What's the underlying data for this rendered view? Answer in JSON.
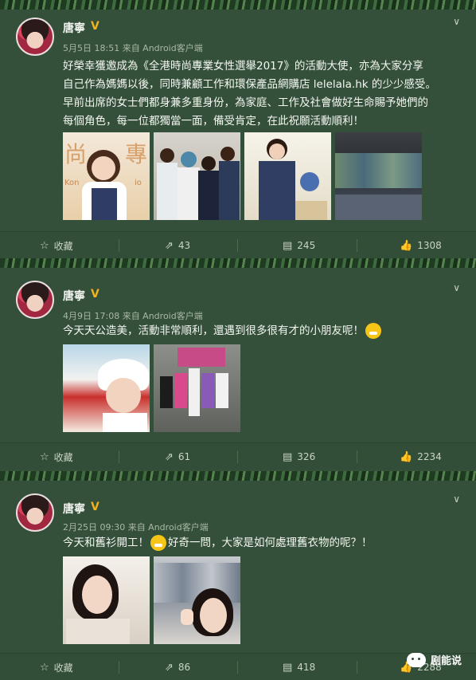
{
  "posts": [
    {
      "username": "唐寧",
      "verified_badge": "V",
      "meta": "5月5日 18:51 来自 Android客户端",
      "text_lines": [
        "好榮幸獲邀成為《全港時尚專業女性選舉2017》的活動大使，亦為大家分享",
        "自己作為媽媽以後，同時兼顧工作和環保產品網購店 lelelala.hk 的少少感受。",
        "早前出席的女士們都身兼多重身份，為家庭、工作及社會做好生命賜予她們的",
        "每個角色，每一位都獨當一面，備受肯定，在此祝願活動順利！"
      ],
      "photo_labels": [
        "尚",
        "專",
        "Kon",
        "io"
      ],
      "actions": {
        "favorite": "收藏",
        "repost": "43",
        "comment": "245",
        "like": "1308"
      }
    },
    {
      "username": "唐寧",
      "verified_badge": "V",
      "meta": "4月9日 17:08 来自 Android客户端",
      "text": "今天天公造美，活動非常順利，還遇到很多很有才的小朋友呢！",
      "actions": {
        "favorite": "收藏",
        "repost": "61",
        "comment": "326",
        "like": "2234"
      }
    },
    {
      "username": "唐寧",
      "verified_badge": "V",
      "meta": "2月25日 09:30 来自 Android客户端",
      "text_before": "今天和舊衫開工！",
      "text_after": "好奇一問，大家是如何處理舊衣物的呢？！",
      "actions": {
        "favorite": "收藏",
        "repost": "86",
        "comment": "418",
        "like": "2288"
      }
    }
  ],
  "icons": {
    "chevron": "chevron-down-icon",
    "favorite": "star-icon",
    "repost": "repost-icon",
    "comment": "comment-icon",
    "like": "thumbs-up-icon"
  },
  "watermark": "剧能说"
}
